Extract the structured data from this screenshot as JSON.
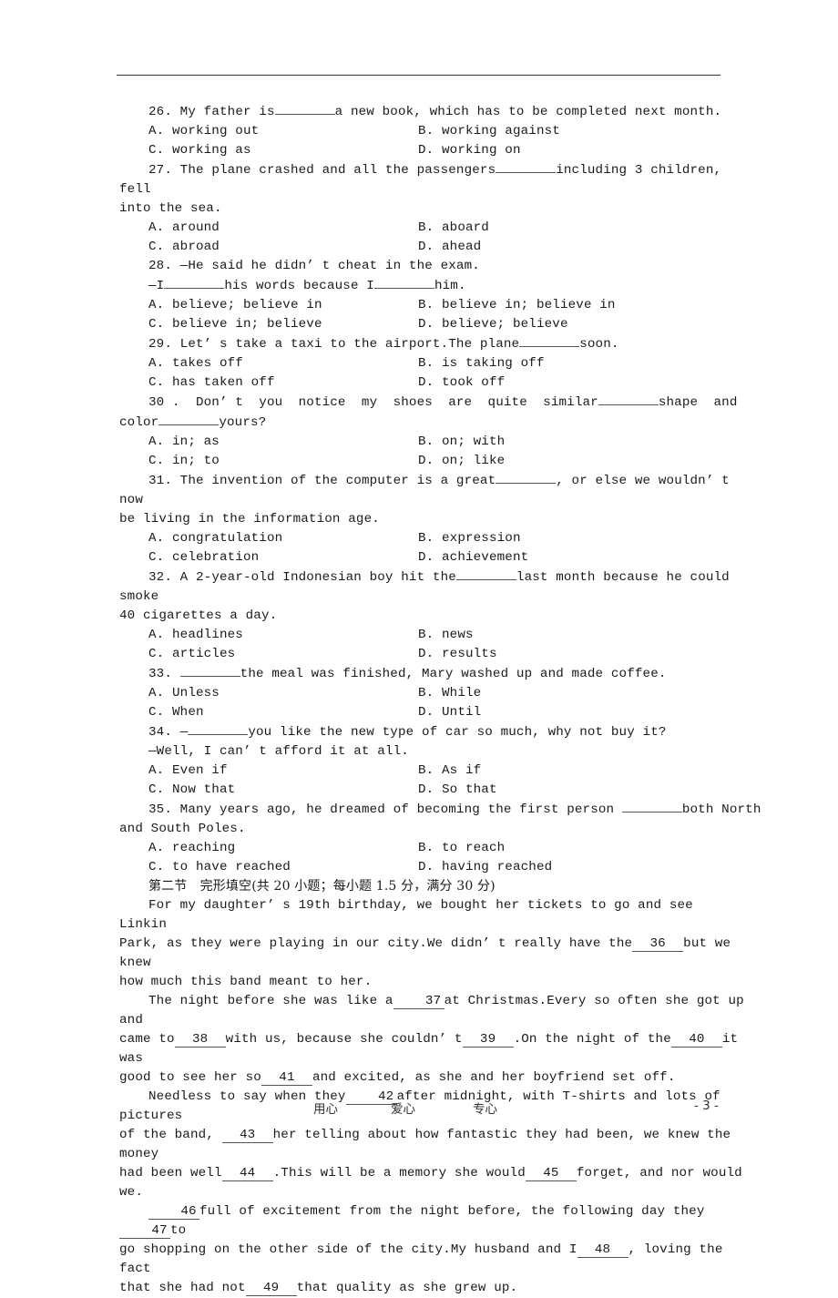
{
  "questions": [
    {
      "num": "26.",
      "stem_before": "My father is",
      "stem_after": "a new book, which has to be completed next month.",
      "options": [
        "A. working out",
        "B. working against",
        "C. working as",
        "D. working on"
      ]
    },
    {
      "num": "27.",
      "stem_before": "The plane crashed and all the passengers",
      "stem_after": "including 3 children, fell",
      "stem_cont": "into the sea.",
      "options": [
        "A. around",
        "B. aboard",
        "C. abroad",
        "D. ahead"
      ]
    },
    {
      "num": "28.",
      "stem_line1": "—He said he didn’ t cheat in the exam.",
      "line2_a": "—I",
      "line2_b": "his words because I",
      "line2_c": "him.",
      "options": [
        "A. believe; believe in",
        "B. believe in; believe in",
        "C. believe in; believe",
        "D. believe; believe"
      ]
    },
    {
      "num": "29.",
      "stem_before": "Let’ s take a taxi to the airport.The plane",
      "stem_after": "soon.",
      "options": [
        "A. takes off",
        "B. is taking off",
        "C. has taken off",
        "D. took off"
      ]
    },
    {
      "num": "30 .",
      "stem_before": "Don’ t  you  notice  my  shoes  are  quite  similar",
      "stem_mid": "shape  and",
      "cont_a": "color",
      "cont_b": "yours?",
      "options": [
        "A. in; as",
        "B. on; with",
        "C. in; to",
        "D. on; like"
      ]
    },
    {
      "num": "31.",
      "stem_before": "The invention of the computer is a great",
      "stem_after": ", or else we wouldn’ t now",
      "stem_cont": "be living in the information age.",
      "options": [
        "A. congratulation",
        "B. expression",
        "C. celebration",
        "D. achievement"
      ]
    },
    {
      "num": "32.",
      "stem_before": "A 2-year-old Indonesian boy hit the",
      "stem_after": "last month because he could smoke",
      "stem_cont": "40 cigarettes a day.",
      "options": [
        "A. headlines",
        "B. news",
        "C. articles",
        "D. results"
      ]
    },
    {
      "num": "33.",
      "stem_before": "",
      "stem_after": "the meal was finished, Mary washed up and made coffee.",
      "options": [
        "A. Unless",
        "B. While",
        "C. When",
        "D. Until"
      ]
    },
    {
      "num": "34.",
      "stem_before": "—",
      "stem_after": "you like the new type of car so much, why not buy it?",
      "stem_line2": "—Well, I can’ t afford it at all.",
      "options": [
        "A. Even if",
        "B. As if",
        "C. Now that",
        "D. So that"
      ]
    },
    {
      "num": "35.",
      "stem_before": "Many years ago, he dreamed of becoming the first person ",
      "stem_after": "both North",
      "stem_cont": "and South Poles.",
      "options": [
        "A. reaching",
        "B. to reach",
        "C. to have reached",
        "D. having reached"
      ]
    }
  ],
  "section_heading": "第二节　完形填空(共 20 小题；每小题 1.5 分，满分 30 分)",
  "passage": {
    "p1": [
      "For my daughter’ s 19th birthday, we bought her tickets to go and see Linkin",
      "Park, as they were playing in our city.We didn’ t really have the",
      "36",
      "but we knew",
      "how much this band meant to her."
    ],
    "p2": [
      "The night before she was like a",
      "37",
      "at Christmas.Every so often she got up and",
      "came to",
      "38",
      "with us, because she couldn’ t",
      "39",
      ".On the night of the",
      "40",
      "it was",
      "good to see her so",
      "41",
      "and excited, as she and her boyfriend set off."
    ],
    "p3": [
      "Needless to say when they",
      "42",
      "after midnight, with T-shirts and lots of pictures",
      "of the band,",
      "43",
      "her telling about how fantastic they had been, we knew the money",
      "had been well",
      "44",
      ".This will be a memory she would",
      "45",
      "forget, and nor would",
      "we."
    ],
    "p4": [
      "46",
      "full of excitement from the night before, the following day they",
      "47",
      "to",
      "go shopping on the other side of the city.My husband and I",
      "48",
      ", loving the fact",
      "that she had not",
      "49",
      "that quality as she grew up."
    ]
  },
  "footer": {
    "item1": "用心",
    "item2": "爱心",
    "item3": "专心",
    "page": "- 3 -"
  }
}
